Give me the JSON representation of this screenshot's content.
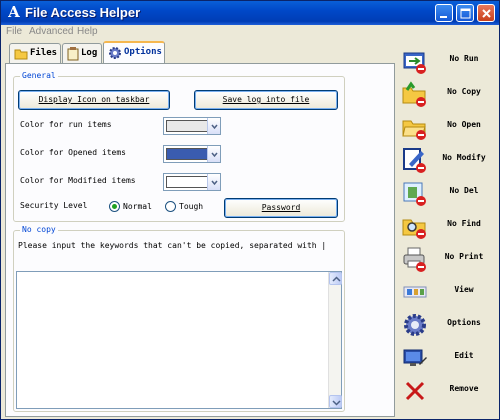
{
  "window": {
    "title": "File Access Helper"
  },
  "menu": {
    "file": "File",
    "advanced": "Advanced",
    "help": "Help"
  },
  "tabs": [
    {
      "label": "Files",
      "icon": "folder-icon"
    },
    {
      "label": "Log",
      "icon": "clipboard-icon"
    },
    {
      "label": "Options",
      "icon": "gear-icon",
      "active": true
    }
  ],
  "general": {
    "title": "General",
    "display_icon_button": "Display Icon on taskbar",
    "save_log_button": "Save log into file",
    "color_run_label": "Color for run items",
    "color_opened_label": "Color for Opened items",
    "color_modified_label": "Color for Modified items",
    "color_run": "#e8e8e8",
    "color_opened": "#3a5cb0",
    "color_modified": "#ffffff",
    "security_label": "Security Level",
    "security_normal": "Normal",
    "security_tough": "Tough",
    "security_selected": "Normal",
    "password_button": "Password"
  },
  "nocopy": {
    "title": "No copy",
    "instruction": "Please input the keywords that can't be copied, separated with |",
    "keywords": ""
  },
  "sidebar": [
    {
      "label": "No Run",
      "icon": "no-run-icon"
    },
    {
      "label": "No Copy",
      "icon": "no-copy-icon"
    },
    {
      "label": "No Open",
      "icon": "no-open-icon"
    },
    {
      "label": "No Modify",
      "icon": "no-modify-icon"
    },
    {
      "label": "No Del",
      "icon": "no-delete-icon"
    },
    {
      "label": "No Find",
      "icon": "no-find-icon"
    },
    {
      "label": "No Print",
      "icon": "no-print-icon"
    },
    {
      "label": "View",
      "icon": "view-icon"
    },
    {
      "label": "Options",
      "icon": "gear-icon"
    },
    {
      "label": "Edit",
      "icon": "edit-icon"
    },
    {
      "label": "Remove",
      "icon": "remove-x-icon"
    }
  ]
}
